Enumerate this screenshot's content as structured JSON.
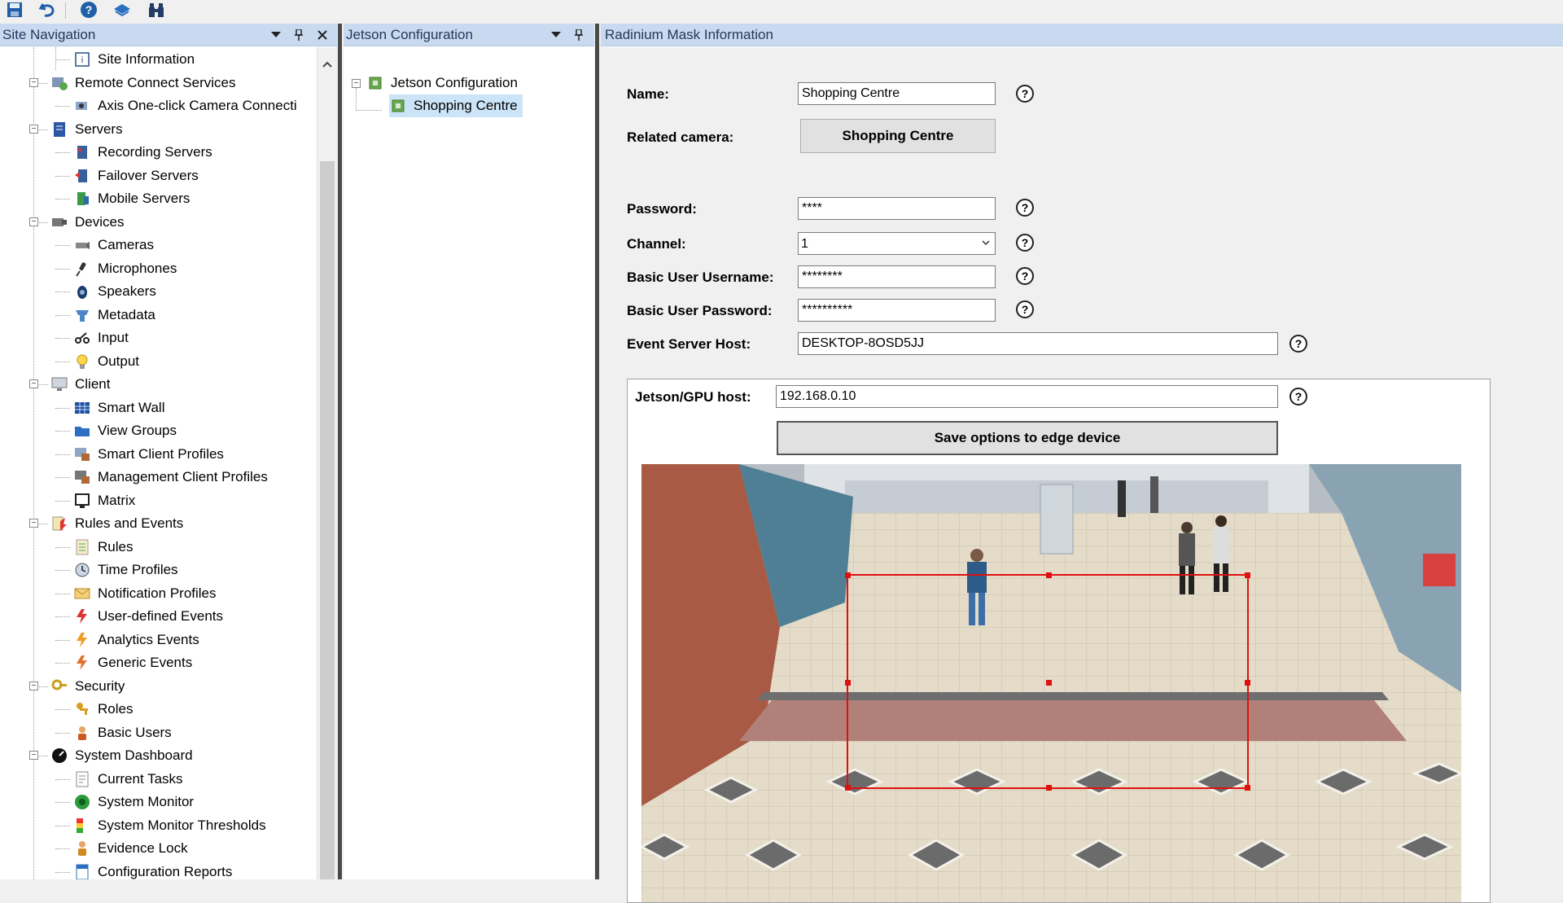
{
  "toolbar": {
    "buttons": [
      {
        "name": "save-icon"
      },
      {
        "name": "undo-icon"
      },
      {
        "name": "help-icon"
      },
      {
        "name": "connect-icon"
      },
      {
        "name": "binoculars-icon"
      }
    ]
  },
  "site_navigation": {
    "title": "Site Navigation",
    "items": [
      {
        "label": "Site Information",
        "icon": "site-info-icon"
      },
      {
        "label": "Remote Connect Services",
        "icon": "remote-connect-icon"
      },
      {
        "label": "Axis One-click Camera Connecti",
        "icon": "axis-camera-icon"
      },
      {
        "label": "Servers",
        "icon": "servers-icon"
      },
      {
        "label": "Recording Servers",
        "icon": "recording-server-icon"
      },
      {
        "label": "Failover Servers",
        "icon": "failover-server-icon"
      },
      {
        "label": "Mobile Servers",
        "icon": "mobile-server-icon"
      },
      {
        "label": "Devices",
        "icon": "devices-icon"
      },
      {
        "label": "Cameras",
        "icon": "camera-icon"
      },
      {
        "label": "Microphones",
        "icon": "microphone-icon"
      },
      {
        "label": "Speakers",
        "icon": "speaker-icon"
      },
      {
        "label": "Metadata",
        "icon": "metadata-icon"
      },
      {
        "label": "Input",
        "icon": "input-icon"
      },
      {
        "label": "Output",
        "icon": "output-bulb-icon"
      },
      {
        "label": "Client",
        "icon": "client-icon"
      },
      {
        "label": "Smart Wall",
        "icon": "smart-wall-icon"
      },
      {
        "label": "View Groups",
        "icon": "view-groups-icon"
      },
      {
        "label": "Smart Client Profiles",
        "icon": "smart-client-profile-icon"
      },
      {
        "label": "Management Client Profiles",
        "icon": "management-client-profile-icon"
      },
      {
        "label": "Matrix",
        "icon": "matrix-icon"
      },
      {
        "label": "Rules and Events",
        "icon": "rules-events-icon"
      },
      {
        "label": "Rules",
        "icon": "rules-icon"
      },
      {
        "label": "Time Profiles",
        "icon": "time-profile-icon"
      },
      {
        "label": "Notification Profiles",
        "icon": "notification-profile-icon"
      },
      {
        "label": "User-defined Events",
        "icon": "user-event-icon"
      },
      {
        "label": "Analytics Events",
        "icon": "analytics-event-icon"
      },
      {
        "label": "Generic Events",
        "icon": "generic-event-icon"
      },
      {
        "label": "Security",
        "icon": "security-icon"
      },
      {
        "label": "Roles",
        "icon": "roles-icon"
      },
      {
        "label": "Basic Users",
        "icon": "basic-users-icon"
      },
      {
        "label": "System Dashboard",
        "icon": "dashboard-icon"
      },
      {
        "label": "Current Tasks",
        "icon": "current-tasks-icon"
      },
      {
        "label": "System Monitor",
        "icon": "system-monitor-icon"
      },
      {
        "label": "System Monitor Thresholds",
        "icon": "thresholds-icon"
      },
      {
        "label": "Evidence Lock",
        "icon": "evidence-lock-icon"
      },
      {
        "label": "Configuration Reports",
        "icon": "config-reports-icon"
      }
    ]
  },
  "jetson_pane": {
    "title": "Jetson Configuration",
    "items": [
      {
        "label": "Jetson Configuration",
        "icon": "jetson-plugin-icon"
      },
      {
        "label": "Shopping Centre",
        "icon": "jetson-device-icon"
      }
    ]
  },
  "mask_panel": {
    "title": "Radinium Mask Information",
    "name_label": "Name:",
    "name_value": "Shopping Centre",
    "related_camera_label": "Related camera:",
    "related_camera_button": "Shopping Centre",
    "password_label": "Password:",
    "password_value": "****",
    "channel_label": "Channel:",
    "channel_value": "1",
    "basic_user_username_label": "Basic User Username:",
    "basic_user_username_value": "********",
    "basic_user_password_label": "Basic User Password:",
    "basic_user_password_value": "**********",
    "event_server_host_label": "Event Server Host:",
    "event_server_host_value": "DESKTOP-8OSD5JJ",
    "jetson_host_label": "Jetson/GPU host:",
    "jetson_host_value": "192.168.0.10",
    "save_button": "Save options to edge device",
    "help_glyph": "?"
  },
  "colors": {
    "pane_header": "#c9daf0",
    "mask_outline": "#e01010",
    "selection": "#cce4f7"
  }
}
